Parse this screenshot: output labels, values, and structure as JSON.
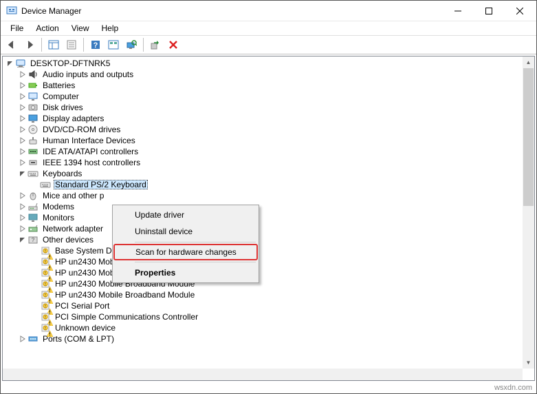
{
  "window": {
    "title": "Device Manager"
  },
  "menubar": {
    "file": "File",
    "action": "Action",
    "view": "View",
    "help": "Help"
  },
  "tree": {
    "root": "DESKTOP-DFTNRK5",
    "categories": [
      {
        "label": "Audio inputs and outputs",
        "expanded": false
      },
      {
        "label": "Batteries",
        "expanded": false
      },
      {
        "label": "Computer",
        "expanded": false
      },
      {
        "label": "Disk drives",
        "expanded": false
      },
      {
        "label": "Display adapters",
        "expanded": false
      },
      {
        "label": "DVD/CD-ROM drives",
        "expanded": false
      },
      {
        "label": "Human Interface Devices",
        "expanded": false
      },
      {
        "label": "IDE ATA/ATAPI controllers",
        "expanded": false
      },
      {
        "label": "IEEE 1394 host controllers",
        "expanded": false
      },
      {
        "label": "Keyboards",
        "expanded": true,
        "children": [
          {
            "label": "Standard PS/2 Keyboard",
            "selected": true
          }
        ]
      },
      {
        "label": "Mice and other p",
        "expanded": false
      },
      {
        "label": "Modems",
        "expanded": false
      },
      {
        "label": "Monitors",
        "expanded": false
      },
      {
        "label": "Network adapter",
        "expanded": false
      },
      {
        "label": "Other devices",
        "expanded": true,
        "children": [
          {
            "label": "Base System De",
            "warn": true
          },
          {
            "label": "HP un2430 Mobile Broadband Module",
            "warn": true
          },
          {
            "label": "HP un2430 Mobile Broadband Module",
            "warn": true
          },
          {
            "label": "HP un2430 Mobile Broadband Module",
            "warn": true
          },
          {
            "label": "HP un2430 Mobile Broadband Module",
            "warn": true
          },
          {
            "label": "PCI Serial Port",
            "warn": true
          },
          {
            "label": "PCI Simple Communications Controller",
            "warn": true
          },
          {
            "label": "Unknown device",
            "warn": true
          }
        ]
      },
      {
        "label": "Ports (COM & LPT)",
        "expanded": false
      }
    ]
  },
  "context_menu": {
    "update": "Update driver",
    "uninstall": "Uninstall device",
    "scan": "Scan for hardware changes",
    "properties": "Properties"
  },
  "watermark": "wsxdn.com"
}
